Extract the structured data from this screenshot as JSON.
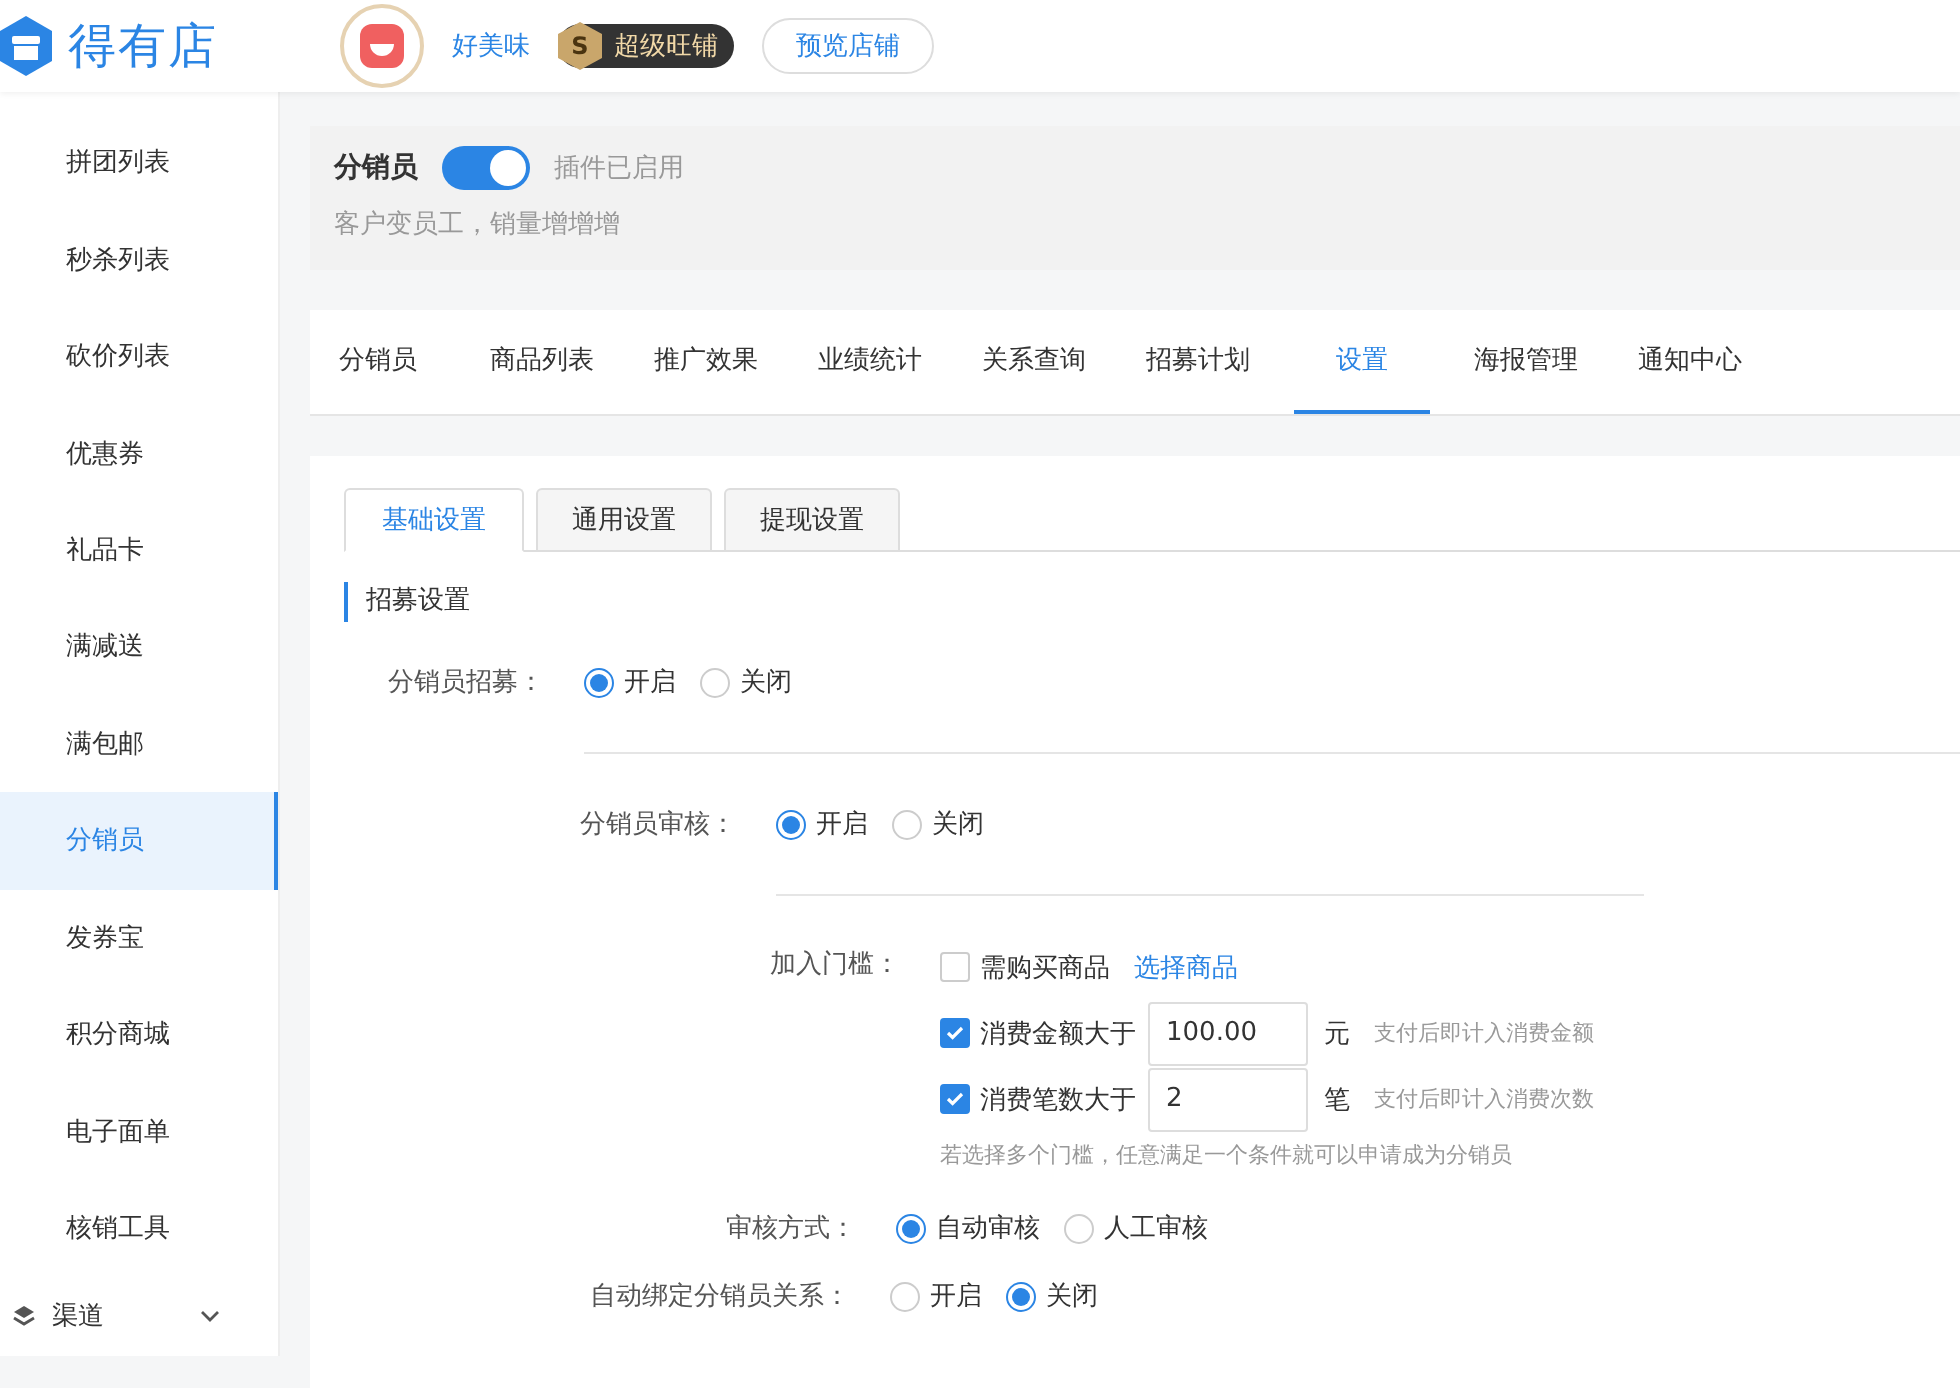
{
  "header": {
    "logo": "得有店",
    "shop_name": "好美味",
    "badge": "超级旺铺",
    "badge_letter": "S",
    "preview_button": "预览店铺"
  },
  "sidebar": {
    "items": [
      {
        "label": "拼团列表",
        "selected": false
      },
      {
        "label": "秒杀列表",
        "selected": false
      },
      {
        "label": "砍价列表",
        "selected": false
      },
      {
        "label": "优惠券",
        "selected": false
      },
      {
        "label": "礼品卡",
        "selected": false
      },
      {
        "label": "满减送",
        "selected": false
      },
      {
        "label": "满包邮",
        "selected": false
      },
      {
        "label": "分销员",
        "selected": true
      },
      {
        "label": "发券宝",
        "selected": false
      },
      {
        "label": "积分商城",
        "selected": false
      },
      {
        "label": "电子面单",
        "selected": false
      },
      {
        "label": "核销工具",
        "selected": false
      }
    ],
    "group": {
      "label": "渠道"
    }
  },
  "plugin": {
    "title": "分销员",
    "enabled": true,
    "status": "插件已启用",
    "description": "客户变员工，销量增增增"
  },
  "tabs": [
    {
      "label": "分销员",
      "selected": false
    },
    {
      "label": "商品列表",
      "selected": false
    },
    {
      "label": "推广效果",
      "selected": false
    },
    {
      "label": "业绩统计",
      "selected": false
    },
    {
      "label": "关系查询",
      "selected": false
    },
    {
      "label": "招募计划",
      "selected": false
    },
    {
      "label": "设置",
      "selected": true
    },
    {
      "label": "海报管理",
      "selected": false
    },
    {
      "label": "通知中心",
      "selected": false
    }
  ],
  "subtabs": [
    {
      "label": "基础设置",
      "selected": true
    },
    {
      "label": "通用设置",
      "selected": false
    },
    {
      "label": "提现设置",
      "selected": false
    }
  ],
  "section_title": "招募设置",
  "form": [
    {
      "kind": "radio",
      "label": "分销员招募：",
      "options": [
        {
          "label": "开启",
          "selected": true
        },
        {
          "label": "关闭",
          "selected": false
        }
      ]
    },
    {
      "kind": "divider"
    },
    {
      "kind": "radio",
      "label": "分销员审核：",
      "options": [
        {
          "label": "开启",
          "selected": true
        },
        {
          "label": "关闭",
          "selected": false
        }
      ]
    },
    {
      "kind": "divider"
    },
    {
      "kind": "threshold",
      "label": "加入门槛：",
      "options": [
        {
          "label": "需购买商品",
          "checked": false,
          "link": "选择商品"
        },
        {
          "label": "消费金额大于",
          "checked": true,
          "value": "100.00",
          "unit": "元",
          "hint": "支付后即计入消费金额"
        },
        {
          "label": "消费笔数大于",
          "checked": true,
          "value": "2",
          "unit": "笔",
          "hint": "支付后即计入消费次数"
        }
      ],
      "note": "若选择多个门槛，任意满足一个条件就可以申请成为分销员"
    },
    {
      "kind": "radio",
      "label": "审核方式：",
      "options": [
        {
          "label": "自动审核",
          "selected": true
        },
        {
          "label": "人工审核",
          "selected": false
        }
      ]
    },
    {
      "kind": "radio",
      "label": "自动绑定分销员关系：",
      "options": [
        {
          "label": "开启",
          "selected": false
        },
        {
          "label": "关闭",
          "selected": true
        }
      ]
    }
  ]
}
